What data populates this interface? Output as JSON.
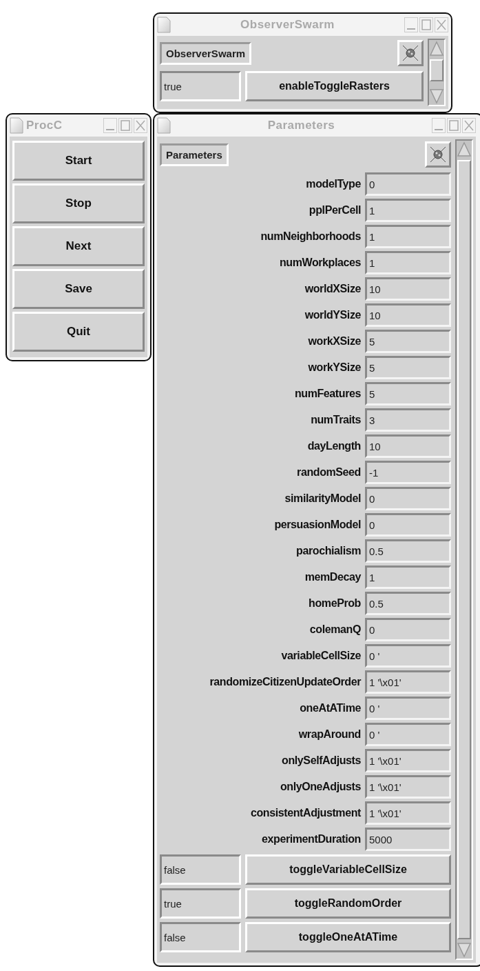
{
  "observer_window": {
    "title": "ObserverSwarm",
    "header_button": "ObserverSwarm",
    "toggles": [
      {
        "value": "true",
        "button": "enableToggleRasters"
      }
    ]
  },
  "control_window": {
    "title": "ProcC",
    "buttons": [
      "Start",
      "Stop",
      "Next",
      "Save",
      "Quit"
    ]
  },
  "parameters_window": {
    "title": "Parameters",
    "header_button": "Parameters",
    "fields": [
      {
        "label": "modelType",
        "value": "0"
      },
      {
        "label": "pplPerCell",
        "value": "1"
      },
      {
        "label": "numNeighborhoods",
        "value": "1"
      },
      {
        "label": "numWorkplaces",
        "value": "1"
      },
      {
        "label": "worldXSize",
        "value": "10"
      },
      {
        "label": "worldYSize",
        "value": "10"
      },
      {
        "label": "workXSize",
        "value": "5"
      },
      {
        "label": "workYSize",
        "value": "5"
      },
      {
        "label": "numFeatures",
        "value": "5"
      },
      {
        "label": "numTraits",
        "value": "3"
      },
      {
        "label": "dayLength",
        "value": "10"
      },
      {
        "label": "randomSeed",
        "value": "-1"
      },
      {
        "label": "similarityModel",
        "value": "0"
      },
      {
        "label": "persuasionModel",
        "value": "0"
      },
      {
        "label": "parochialism",
        "value": "0.5"
      },
      {
        "label": "memDecay",
        "value": "1"
      },
      {
        "label": "homeProb",
        "value": "0.5"
      },
      {
        "label": "colemanQ",
        "value": "0"
      },
      {
        "label": "variableCellSize",
        "value": "0 '"
      },
      {
        "label": "randomizeCitizenUpdateOrder",
        "value": "1 '\\x01'"
      },
      {
        "label": "oneAtATime",
        "value": "0 '"
      },
      {
        "label": "wrapAround",
        "value": "0 '"
      },
      {
        "label": "onlySelfAdjusts",
        "value": "1 '\\x01'"
      },
      {
        "label": "onlyOneAdjusts",
        "value": "1 '\\x01'"
      },
      {
        "label": "consistentAdjustment",
        "value": "1 '\\x01'"
      },
      {
        "label": "experimentDuration",
        "value": "5000"
      }
    ],
    "toggles": [
      {
        "value": "false",
        "button": "toggleVariableCellSize"
      },
      {
        "value": "true",
        "button": "toggleRandomOrder"
      },
      {
        "value": "false",
        "button": "toggleOneAtATime"
      }
    ]
  }
}
